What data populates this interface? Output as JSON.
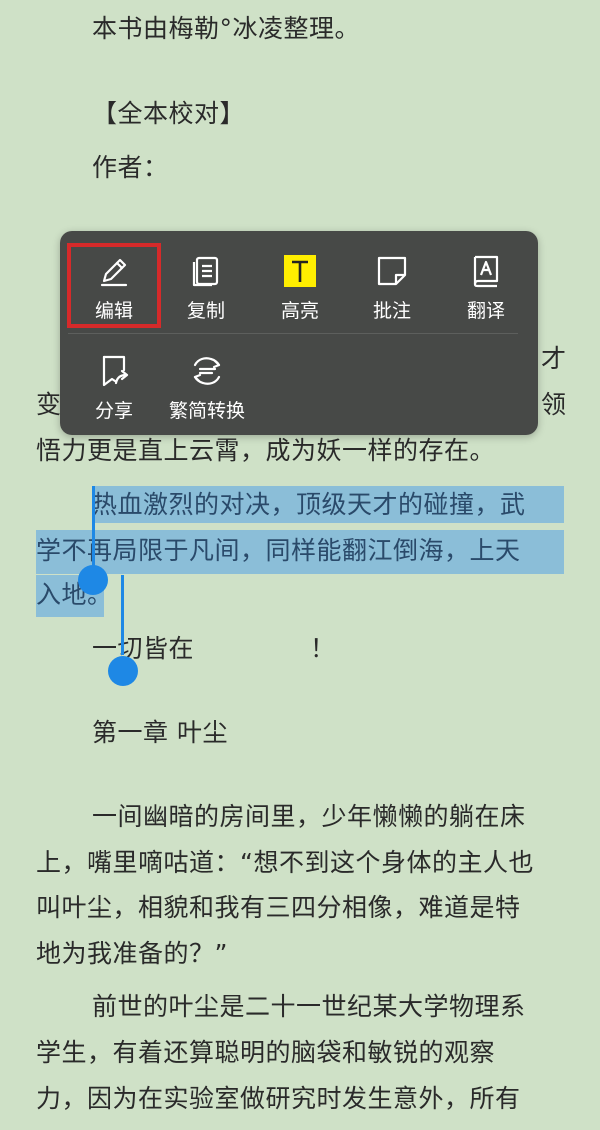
{
  "book": {
    "lines": [
      "本书由梅勒°冰凌整理。",
      "【全本校对】",
      "作者：",
      "才",
      "变",
      "领",
      "悟力更是直上云霄，成为妖一样的存在。",
      "热血激烈的对决，顶级天才的碰撞，武",
      "学不再局限于凡间，同样能翻江倒海，上天",
      "入地。",
      "一切皆在",
      "！",
      "第一章 叶尘",
      "一间幽暗的房间里，少年懒懒的躺在床",
      "上，嘴里嘀咕道：“想不到这个身体的主人也",
      "叫叶尘，相貌和我有三四分相像，难道是特",
      "地为我准备的？”",
      "前世的叶尘是二十一世纪某大学物理系",
      "学生，有着还算聪明的脑袋和敏锐的观察",
      "力，因为在实验室做研究时发生意外，所有"
    ]
  },
  "menu": {
    "items": [
      {
        "label": "编辑",
        "icon": "edit-pen-icon"
      },
      {
        "label": "复制",
        "icon": "copy-icon"
      },
      {
        "label": "高亮",
        "icon": "highlight-icon"
      },
      {
        "label": "批注",
        "icon": "note-icon"
      },
      {
        "label": "翻译",
        "icon": "translate-icon"
      },
      {
        "label": "分享",
        "icon": "share-icon"
      },
      {
        "label": "繁简转换",
        "icon": "convert-icon"
      }
    ]
  },
  "colors": {
    "background": "#cfe1c7",
    "selection": "#7fb7da",
    "handle": "#1e88e5",
    "highlight_icon": "#ffee00",
    "focus_frame": "#d62a2a"
  }
}
